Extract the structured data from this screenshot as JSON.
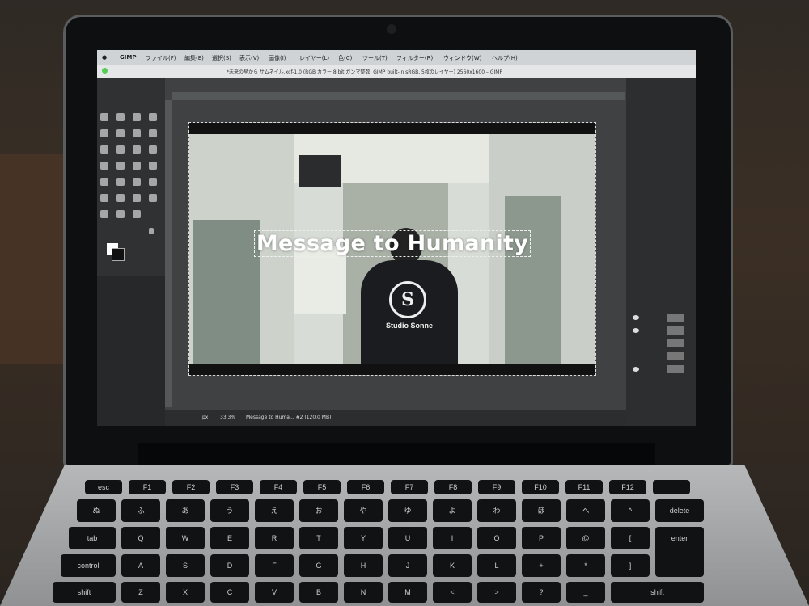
{
  "menubar": {
    "app": "GIMP",
    "items": [
      "ファイル(F)",
      "編集(E)",
      "選択(S)",
      "表示(V)",
      "画像(I)",
      "レイヤー(L)",
      "色(C)",
      "ツール(T)",
      "フィルター(R)",
      "ウィンドウ(W)",
      "ヘルプ(H)"
    ]
  },
  "titlebar": {
    "title": "*未来の星から サムネイル.xcf-1.0 (RGB カラー 8 bit ガンマ整数, GIMP built-in sRGB, 5枚のレイヤー) 2560x1600 – GIMP"
  },
  "canvas": {
    "headline": "Message to Humanity",
    "shirt_text": "Studio Sonne",
    "logo_glyph": "S"
  },
  "status": {
    "unit": "px",
    "zoom": "33.3%",
    "layer_info": "Message to Huma... #2 (120.0 MB)"
  },
  "keyboard": {
    "fn_row": [
      "esc",
      "F1",
      "F2",
      "F3",
      "F4",
      "F5",
      "F6",
      "F7",
      "F8",
      "F9",
      "F10",
      "F11",
      "F12",
      ""
    ],
    "num_row": [
      "ぬ",
      "ふ",
      "あ",
      "う",
      "え",
      "お",
      "や",
      "ゆ",
      "よ",
      "わ",
      "ほ",
      "へ",
      "^",
      "delete"
    ],
    "q_row": [
      "tab",
      "Q",
      "W",
      "E",
      "R",
      "T",
      "Y",
      "U",
      "I",
      "O",
      "P",
      "@",
      "[",
      "enter"
    ],
    "a_row": [
      "control",
      "A",
      "S",
      "D",
      "F",
      "G",
      "H",
      "J",
      "K",
      "L",
      "+",
      "*",
      "]",
      ""
    ],
    "z_row": [
      "shift",
      "Z",
      "X",
      "C",
      "V",
      "B",
      "N",
      "M",
      "<",
      ">",
      "?",
      "_",
      "shift"
    ]
  }
}
